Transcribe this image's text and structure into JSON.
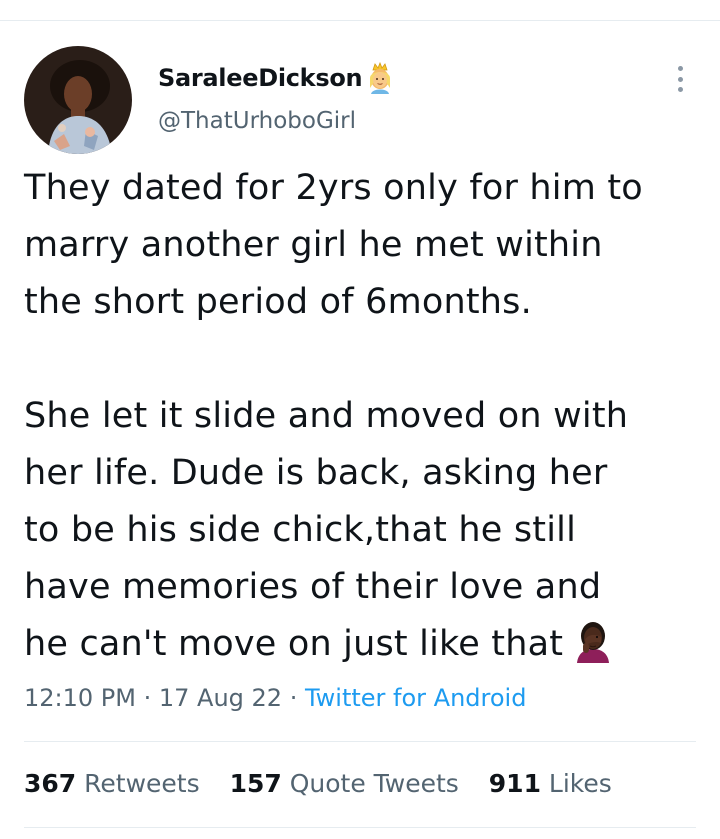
{
  "author": {
    "display_name": "SaraleeDickson",
    "name_emoji": "princess-emoji",
    "handle": "@ThatUrhoboGirl"
  },
  "tweet": {
    "paragraphs": [
      {
        "lines": [
          "They dated for 2yrs only for him to",
          "marry another girl he met within",
          "the short period of 6months."
        ]
      },
      {
        "lines": [
          "She let it slide and moved on with",
          "her life. Dude is back, asking her",
          "to be his side chick,that he still",
          "have memories of their love and",
          "he can't move on just like that"
        ]
      }
    ],
    "trailing_emoji": "facepalm-emoji"
  },
  "meta": {
    "time": "12:10 PM",
    "sep1": " · ",
    "date": "17 Aug 22",
    "sep2": " · ",
    "source": "Twitter for Android"
  },
  "stats": {
    "retweets": {
      "count": "367",
      "label": "Retweets"
    },
    "quotes": {
      "count": "157",
      "label": "Quote Tweets"
    },
    "likes": {
      "count": "911",
      "label": "Likes"
    }
  },
  "colors": {
    "text": "#0f1419",
    "secondary": "#536471",
    "link": "#1d9bf0",
    "divider": "#e6ecf0"
  }
}
